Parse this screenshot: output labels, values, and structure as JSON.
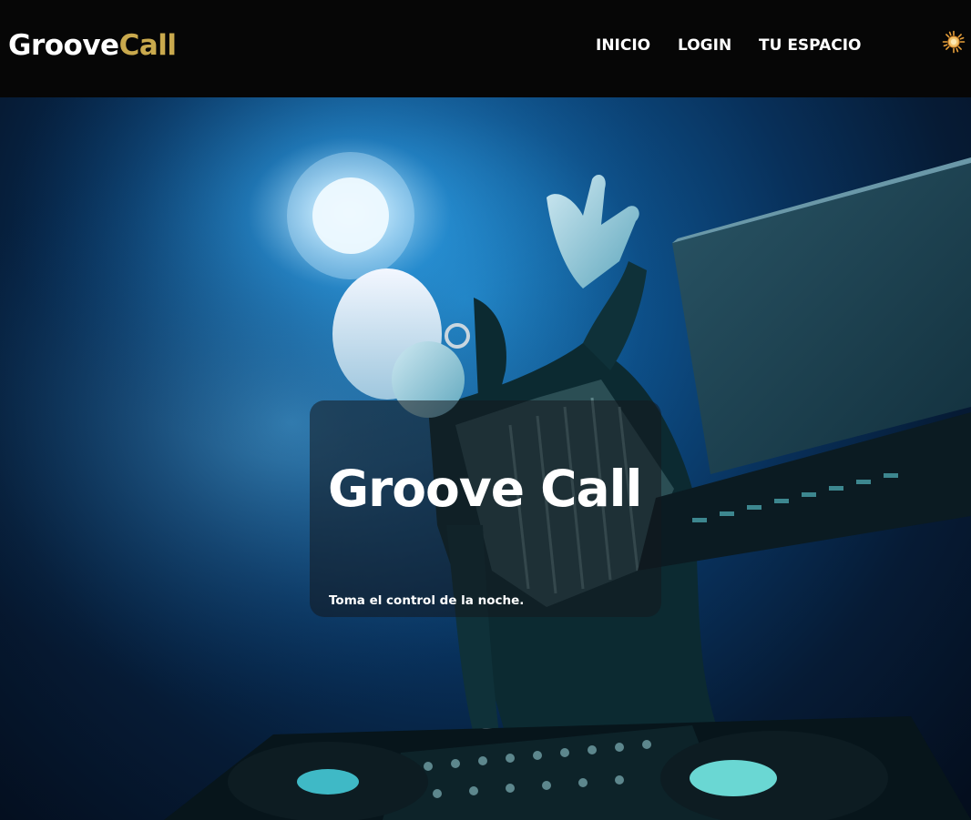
{
  "header": {
    "brand_part1": "Groove",
    "brand_part2": "Call",
    "nav": [
      {
        "label": "INICIO"
      },
      {
        "label": "LOGIN"
      },
      {
        "label": "TU ESPACIO"
      }
    ],
    "theme_toggle_icon": "sun-icon"
  },
  "hero": {
    "title": "Groove Call",
    "subtitle": "Toma el control de la noche.",
    "image_icon": "dj-performer-photo"
  },
  "colors": {
    "brand_accent": "#c9a94d",
    "navbar_bg": "#060606",
    "text_primary": "#ffffff",
    "hero_glow": "#1f8fd6"
  }
}
